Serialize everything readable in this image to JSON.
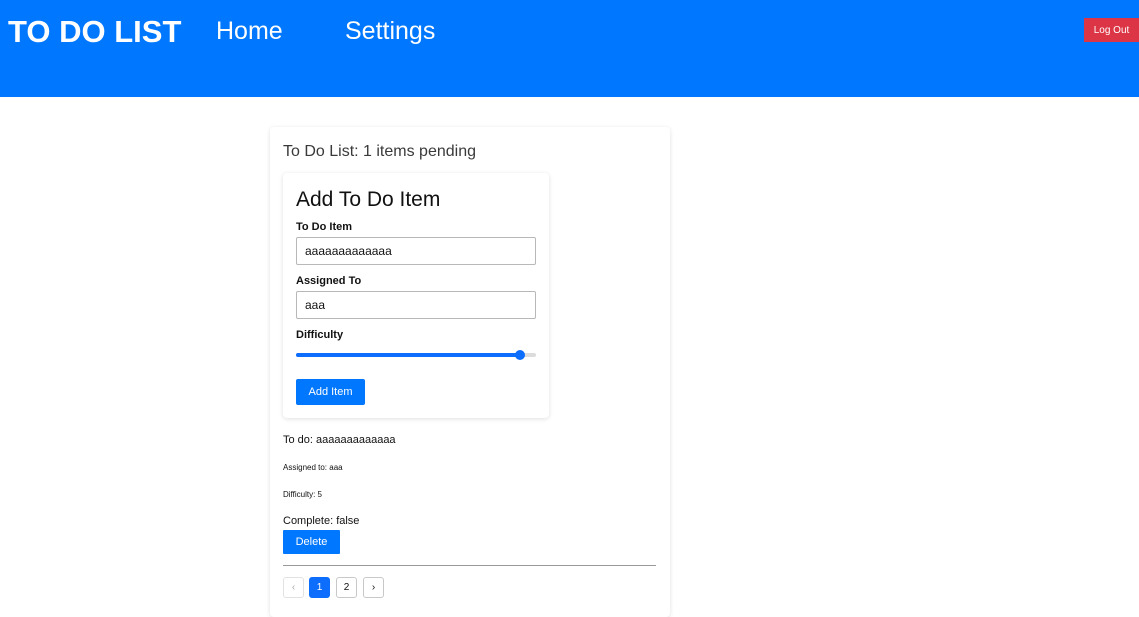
{
  "header": {
    "brand": "TO DO LIST",
    "nav": {
      "home": "Home",
      "settings": "Settings"
    },
    "logout_label": "Log Out",
    "background_color": "#0077ff"
  },
  "list": {
    "title": "To Do List: 1 items pending"
  },
  "form": {
    "title": "Add To Do Item",
    "todo_label": "To Do Item",
    "todo_value": "aaaaaaaaaaaaa",
    "assigned_label": "Assigned To",
    "assigned_value": "aaa",
    "difficulty_label": "Difficulty",
    "difficulty_fraction": 0.95,
    "submit_label": "Add Item"
  },
  "item": {
    "todo": "To do: aaaaaaaaaaaaa",
    "assigned": "Assigned to: aaa",
    "difficulty": "Difficulty: 5",
    "complete": "Complete: false",
    "delete_label": "Delete"
  },
  "pagination": {
    "prev_icon": "‹",
    "pages": [
      "1",
      "2"
    ],
    "current": "1",
    "next_icon": "›"
  },
  "colors": {
    "primary": "#0077ff",
    "danger": "#dc3545",
    "slider": "#0d6efd"
  }
}
